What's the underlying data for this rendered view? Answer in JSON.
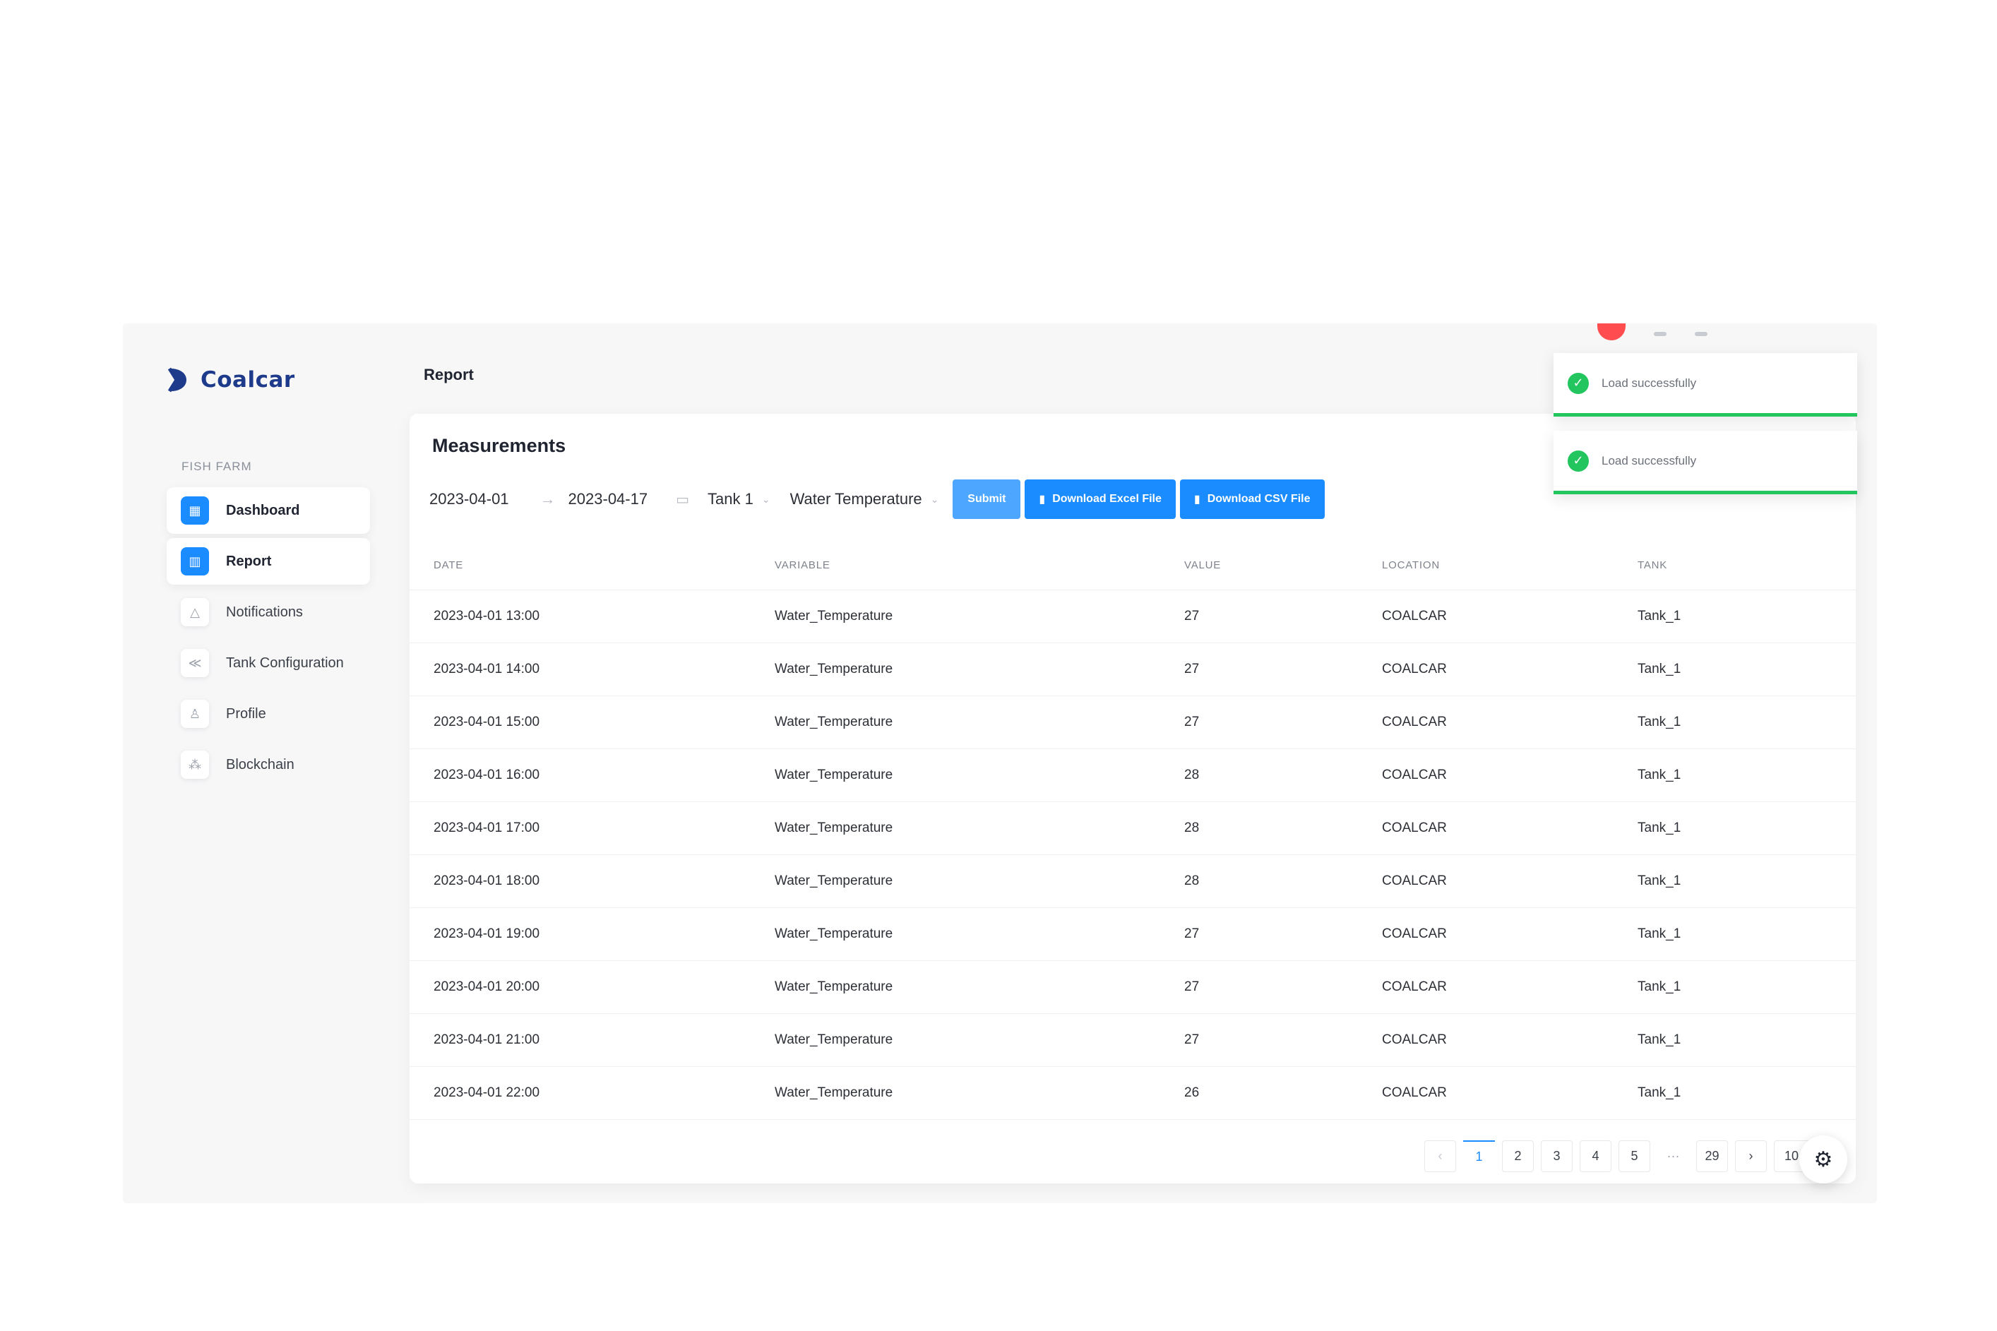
{
  "app": {
    "brand": "Coalcar",
    "page_title": "Report",
    "brand_color": "#1e3a8a",
    "accent_color": "#1a8cff"
  },
  "sidebar": {
    "section_label": "FISH FARM",
    "items": [
      {
        "label": "Dashboard",
        "icon": "dashboard-icon"
      },
      {
        "label": "Report",
        "icon": "chart-icon"
      },
      {
        "label": "Notifications",
        "icon": "bell-icon"
      },
      {
        "label": "Tank Configuration",
        "icon": "share-icon"
      },
      {
        "label": "Profile",
        "icon": "user-icon"
      },
      {
        "label": "Blockchain",
        "icon": "blockchain-icon"
      }
    ]
  },
  "measurements": {
    "title": "Measurements",
    "start_date": "2023-04-01",
    "end_date": "2023-04-17",
    "tank": "Tank 1",
    "variable": "Water Temperature",
    "submit_label": "Submit",
    "download_excel_label": "Download Excel File",
    "download_csv_label": "Download CSV File"
  },
  "table": {
    "columns": [
      "DATE",
      "VARIABLE",
      "VALUE",
      "LOCATION",
      "TANK"
    ],
    "rows": [
      [
        "2023-04-01 13:00",
        "Water_Temperature",
        "27",
        "COALCAR",
        "Tank_1"
      ],
      [
        "2023-04-01 14:00",
        "Water_Temperature",
        "27",
        "COALCAR",
        "Tank_1"
      ],
      [
        "2023-04-01 15:00",
        "Water_Temperature",
        "27",
        "COALCAR",
        "Tank_1"
      ],
      [
        "2023-04-01 16:00",
        "Water_Temperature",
        "28",
        "COALCAR",
        "Tank_1"
      ],
      [
        "2023-04-01 17:00",
        "Water_Temperature",
        "28",
        "COALCAR",
        "Tank_1"
      ],
      [
        "2023-04-01 18:00",
        "Water_Temperature",
        "28",
        "COALCAR",
        "Tank_1"
      ],
      [
        "2023-04-01 19:00",
        "Water_Temperature",
        "27",
        "COALCAR",
        "Tank_1"
      ],
      [
        "2023-04-01 20:00",
        "Water_Temperature",
        "27",
        "COALCAR",
        "Tank_1"
      ],
      [
        "2023-04-01 21:00",
        "Water_Temperature",
        "27",
        "COALCAR",
        "Tank_1"
      ],
      [
        "2023-04-01 22:00",
        "Water_Temperature",
        "26",
        "COALCAR",
        "Tank_1"
      ]
    ]
  },
  "pagination": {
    "pages": [
      "1",
      "2",
      "3",
      "4",
      "5"
    ],
    "current_page": "1",
    "ellipsis": "···",
    "last_page": "29",
    "page_size": "10 /"
  },
  "toasts": [
    {
      "message": "Load successfully",
      "status_color": "#22c55e"
    },
    {
      "message": "Load successfully",
      "status_color": "#22c55e"
    }
  ]
}
